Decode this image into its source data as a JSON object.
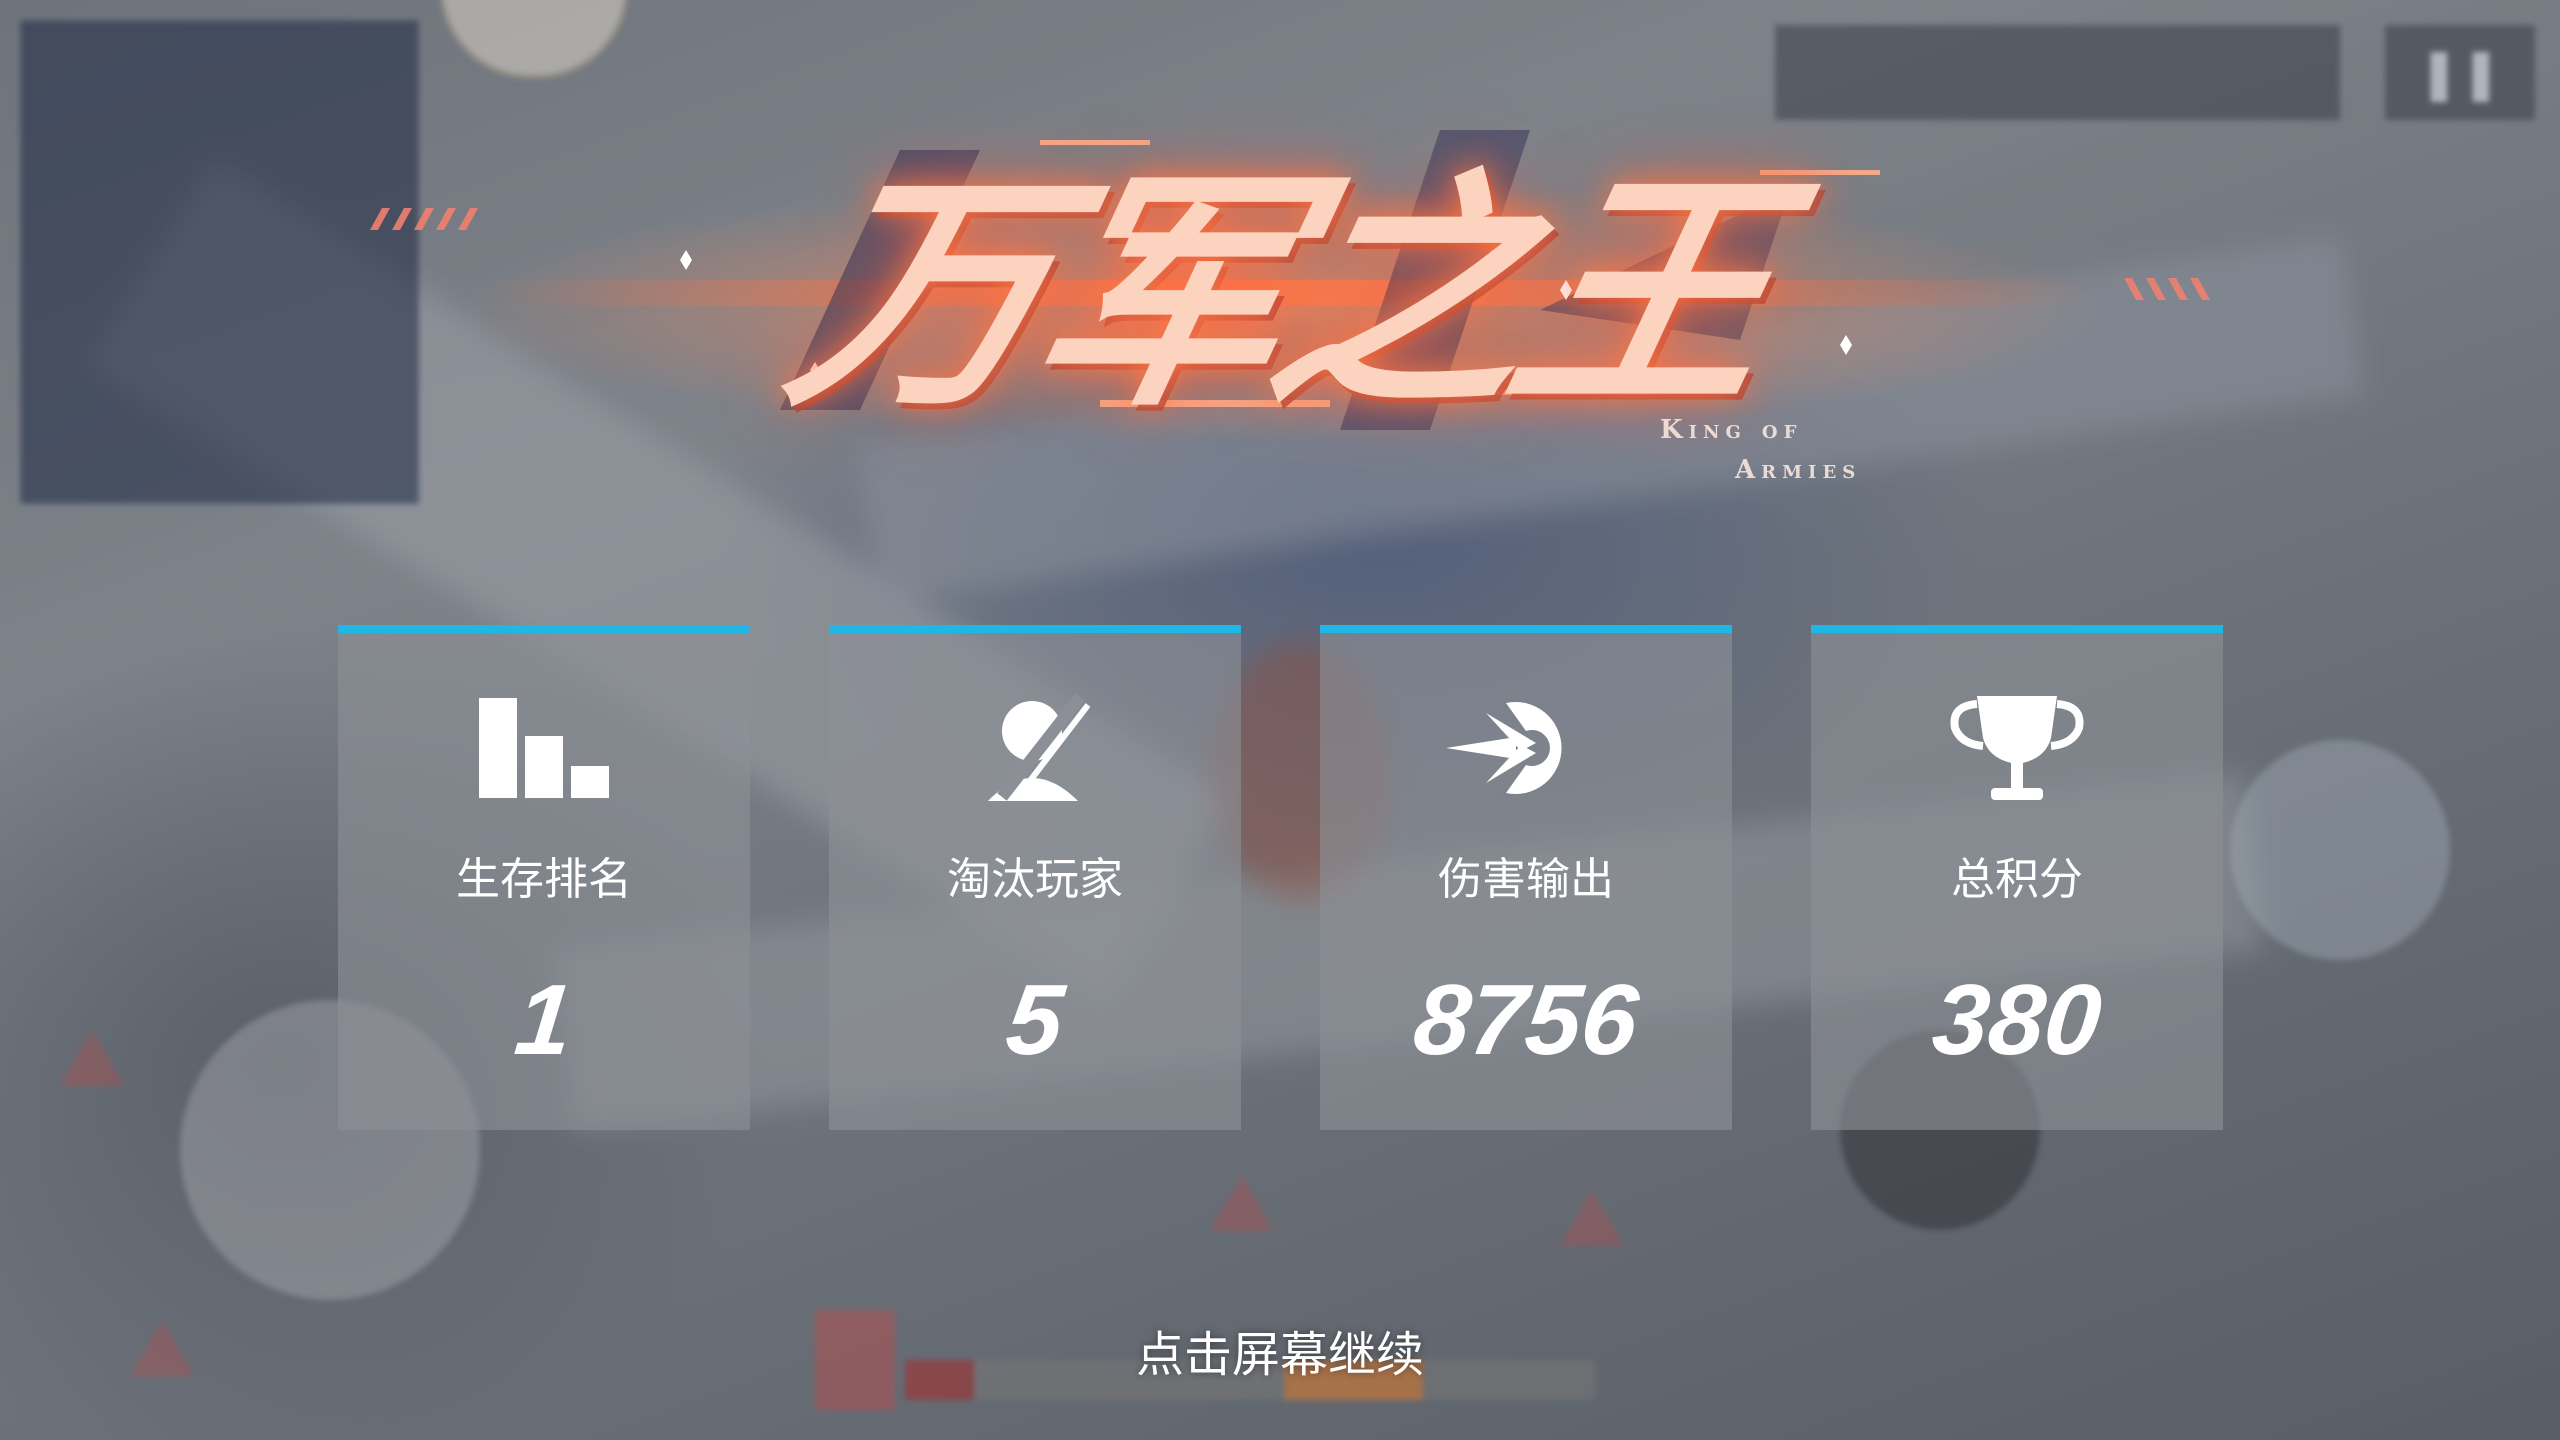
{
  "title": {
    "main": "万军之王",
    "subtitle_line1": "King of",
    "subtitle_line2": "Armies"
  },
  "stats": [
    {
      "icon": "rank-bars-icon",
      "label": "生存排名",
      "value": "1"
    },
    {
      "icon": "eliminate-player-icon",
      "label": "淘汰玩家",
      "value": "5"
    },
    {
      "icon": "damage-projectile-icon",
      "label": "伤害输出",
      "value": "8756"
    },
    {
      "icon": "trophy-icon",
      "label": "总积分",
      "value": "380"
    }
  ],
  "continue_prompt": "点击屏幕继续",
  "colors": {
    "card_accent": "#1fb8e6",
    "title_glow": "#ff7a4a",
    "card_bg": "#8c9096"
  }
}
